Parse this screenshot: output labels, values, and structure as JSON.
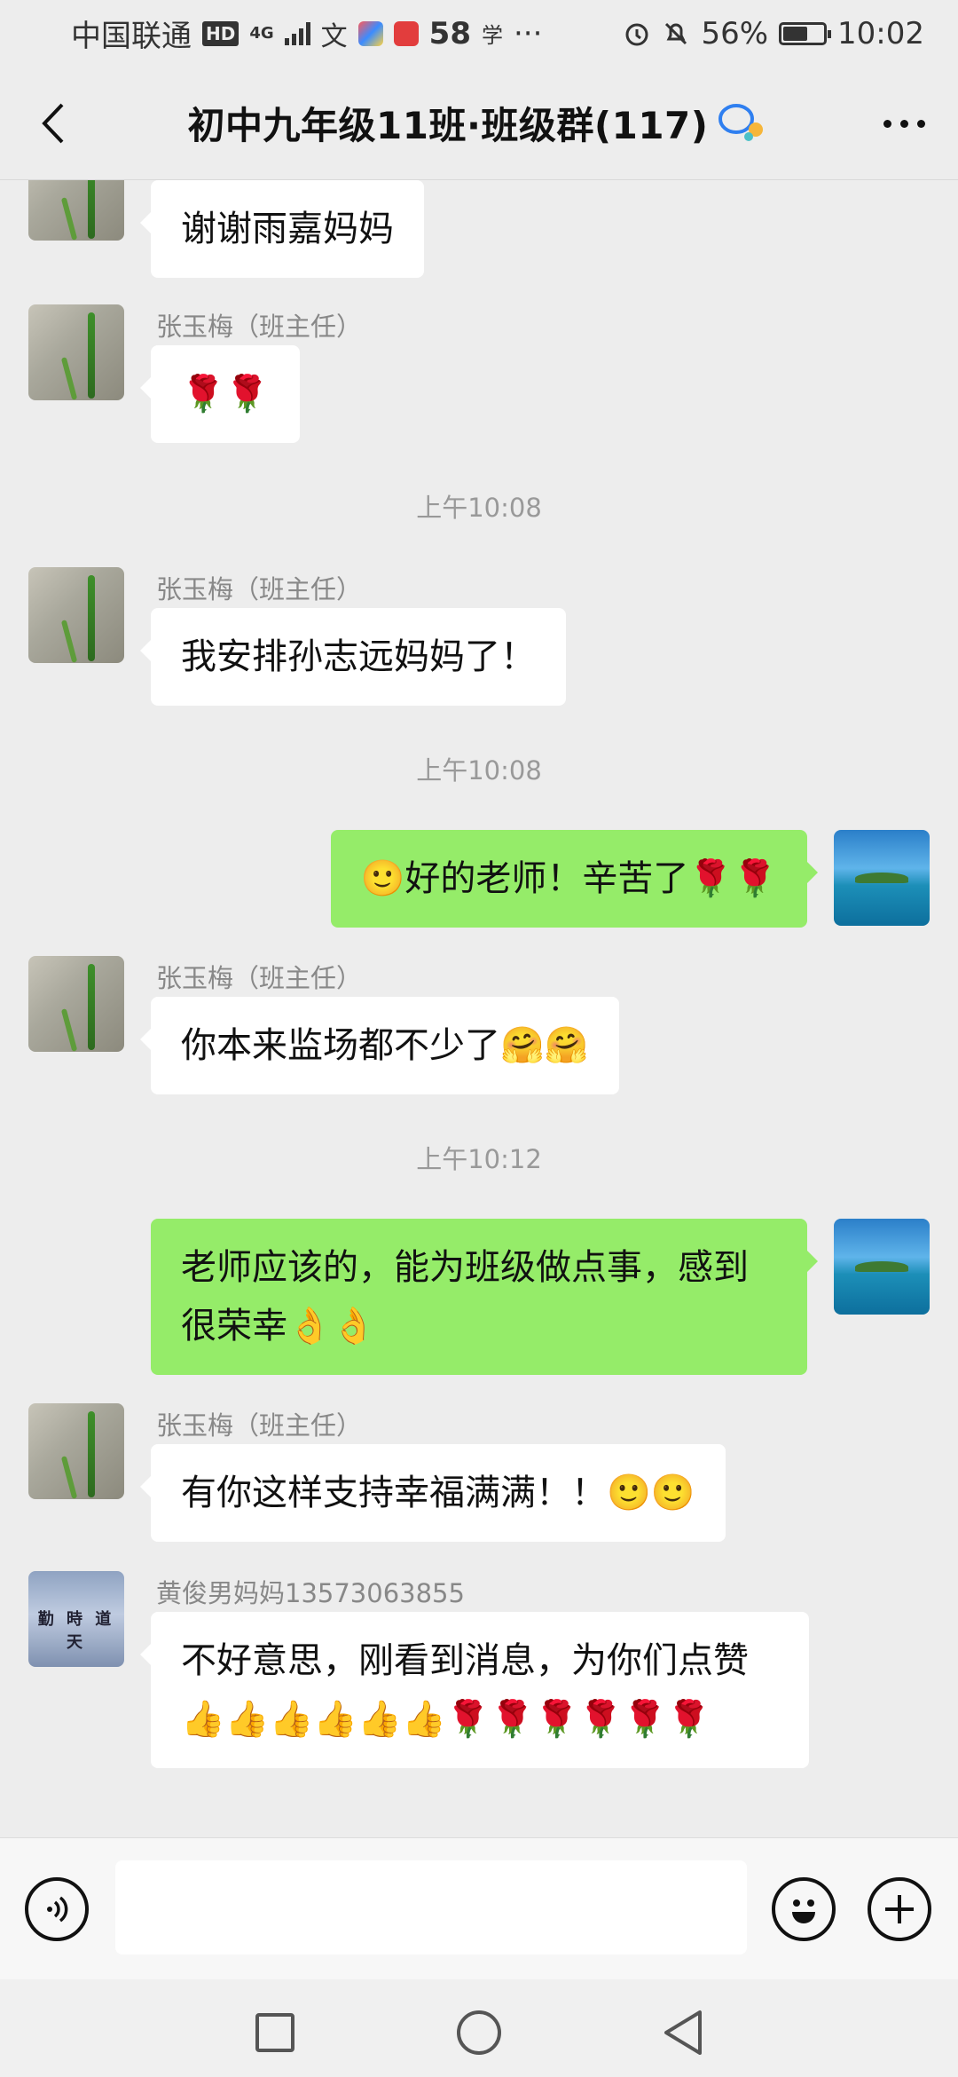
{
  "status_bar": {
    "carrier": "中国联通",
    "hd": "HD",
    "network": "4G",
    "app_badge": "58",
    "more": "···",
    "battery": "56%",
    "time": "10:02"
  },
  "header": {
    "title": "初中九年级11班·班级群(117)"
  },
  "messages": [
    {
      "type": "text",
      "direction": "in",
      "sender": "",
      "avatar": "plant-avatar",
      "text": "谢谢雨嘉妈妈"
    },
    {
      "type": "text",
      "direction": "in",
      "sender": "张玉梅（班主任）",
      "avatar": "plant-avatar",
      "text": "🌹🌹"
    },
    {
      "type": "time",
      "text": "上午10:08"
    },
    {
      "type": "text",
      "direction": "in",
      "sender": "张玉梅（班主任）",
      "avatar": "plant-avatar",
      "text": "我安排孙志远妈妈了！"
    },
    {
      "type": "time",
      "text": "上午10:08"
    },
    {
      "type": "text",
      "direction": "out",
      "avatar": "sea-avatar",
      "text": "🙂好的老师！辛苦了🌹🌹"
    },
    {
      "type": "text",
      "direction": "in",
      "sender": "张玉梅（班主任）",
      "avatar": "plant-avatar",
      "text": "你本来监场都不少了🤗🤗"
    },
    {
      "type": "time",
      "text": "上午10:12"
    },
    {
      "type": "text",
      "direction": "out",
      "avatar": "sea-avatar",
      "text": "老师应该的，能为班级做点事，感到很荣幸👌👌"
    },
    {
      "type": "text",
      "direction": "in",
      "sender": "张玉梅（班主任）",
      "avatar": "plant-avatar",
      "text": "有你这样支持幸福满满！！🙂🙂"
    },
    {
      "type": "text",
      "direction": "in",
      "sender": "黄俊男妈妈13573063855",
      "avatar": "calligraphy-avatar",
      "avatar_text": "勤 時 道 天",
      "text": "不好意思，刚看到消息，为你们点赞👍👍👍👍👍👍🌹🌹🌹🌹🌹🌹"
    }
  ],
  "input_bar": {
    "placeholder": ""
  }
}
